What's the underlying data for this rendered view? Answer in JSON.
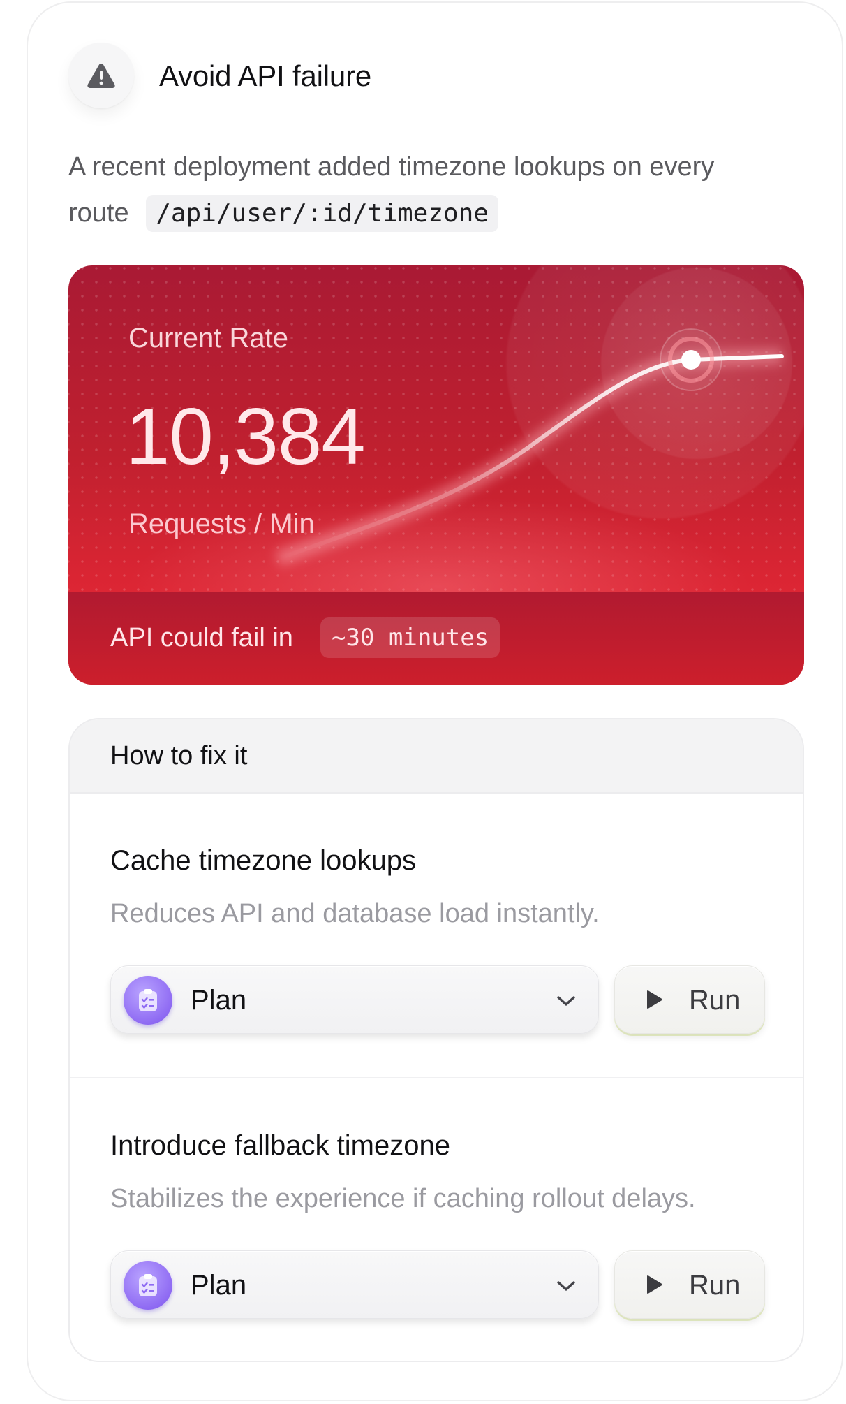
{
  "header": {
    "icon": "warning-triangle-icon",
    "title": "Avoid API failure"
  },
  "description": {
    "text_line": "A recent deployment added timezone lookups on every route",
    "route_code": "/api/user/:id/timezone"
  },
  "rate_card": {
    "label": "Current Rate",
    "value": "10,384",
    "unit": "Requests / Min",
    "footer_text": "API could fail in",
    "footer_highlight": "~30 minutes",
    "colors": {
      "card_top": "#a91a34",
      "card_bottom": "#e32835",
      "curve": "#ffffff"
    }
  },
  "fix_panel": {
    "header": "How to fix it",
    "items": [
      {
        "title": "Cache timezone lookups",
        "description": "Reduces API and database load instantly.",
        "select_value": "Plan",
        "select_icon": "clipboard-checklist-icon",
        "run_label": "Run"
      },
      {
        "title": "Introduce fallback timezone",
        "description": "Stabilizes the experience if caching rollout delays.",
        "select_value": "Plan",
        "select_icon": "clipboard-checklist-icon",
        "run_label": "Run"
      }
    ]
  }
}
